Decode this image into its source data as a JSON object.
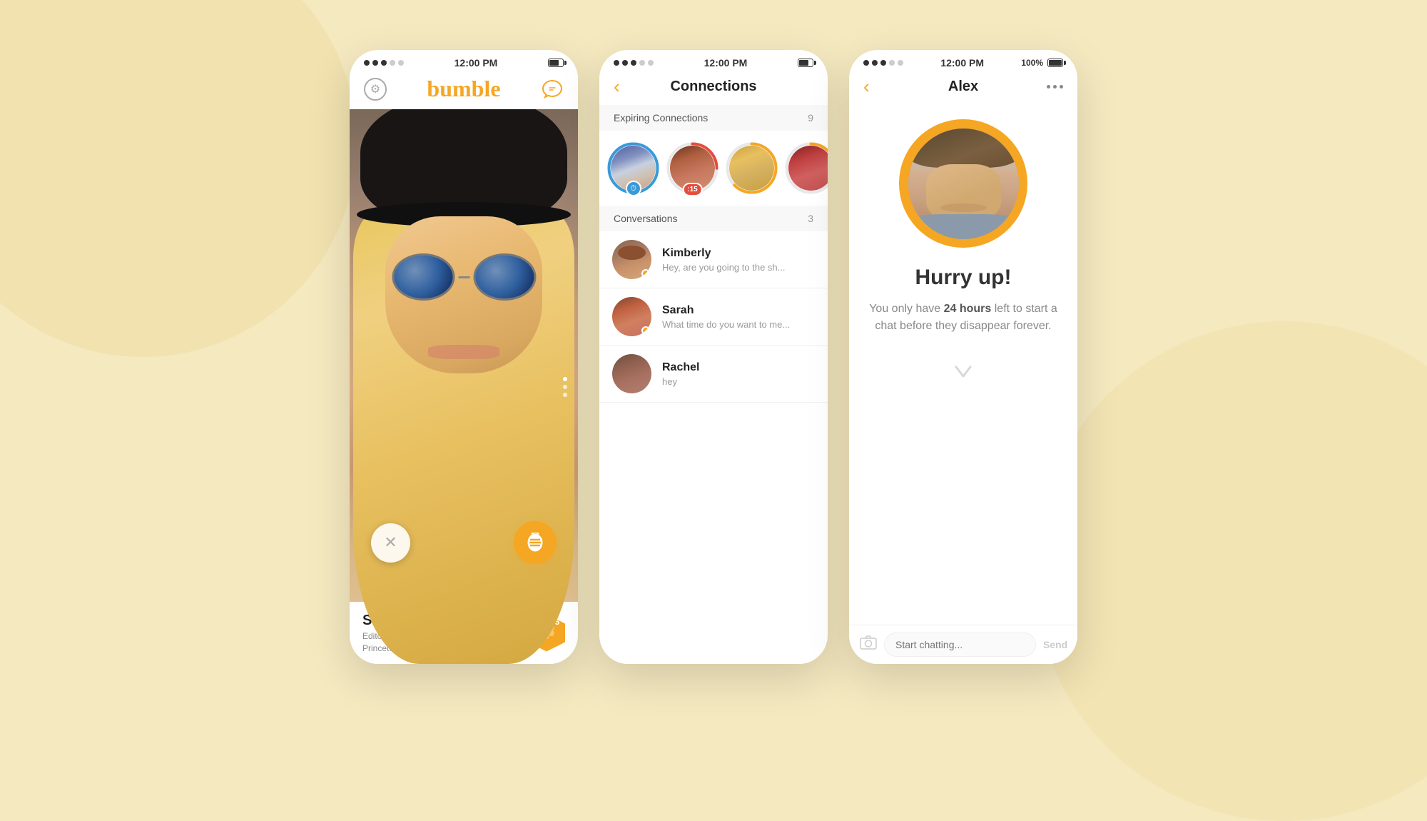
{
  "app": {
    "name": "bumble",
    "background_color": "#f5e9c0"
  },
  "phone1": {
    "status_bar": {
      "dots": [
        1,
        1,
        1,
        0,
        0
      ],
      "time": "12:00 PM",
      "battery": 70
    },
    "header": {
      "settings_label": "⚙",
      "logo": "bumble",
      "chat_icon": "💬"
    },
    "profile": {
      "name": "Samantha, 20",
      "job": "Editorial Intern at Elle Magazine",
      "university": "Princeton University, 2016",
      "honey_count": "5"
    },
    "swipe": {
      "pass_label": "✕",
      "like_label": "🐝"
    }
  },
  "phone2": {
    "status_bar": {
      "time": "12:00 PM"
    },
    "header": {
      "back_label": "‹",
      "title": "Connections"
    },
    "expiring": {
      "title": "Expiring Connections",
      "count": "9"
    },
    "conversations": {
      "title": "Conversations",
      "count": "3",
      "items": [
        {
          "name": "Kimberly",
          "preview": "Hey, are you going to the sh...",
          "has_unread": true
        },
        {
          "name": "Sarah",
          "preview": "What time do you want to me...",
          "has_unread": true
        },
        {
          "name": "Rachel",
          "preview": "hey",
          "has_unread": false
        }
      ]
    }
  },
  "phone3": {
    "status_bar": {
      "time": "12:00 PM",
      "battery_text": "100%"
    },
    "header": {
      "back_label": "‹",
      "title": "Alex"
    },
    "content": {
      "headline": "Hurry up!",
      "description_part1": "You only have ",
      "hours": "24 hours",
      "description_part2": " left to start a chat before they disappear forever."
    },
    "chat": {
      "placeholder": "Start chatting...",
      "send_label": "Send",
      "camera_icon": "📷"
    }
  }
}
